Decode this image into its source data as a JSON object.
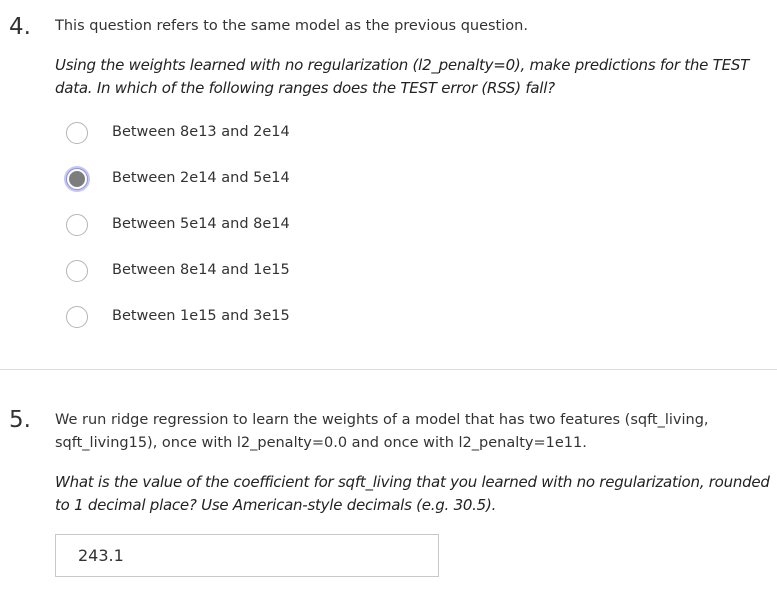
{
  "q4": {
    "number": "4.",
    "intro": "This question refers to the same model as the previous question.",
    "prompt_line1": "Using the weights learned with no regularization (l2_penalty=0), make predictions for the TEST",
    "prompt_line2": "data. In which of the following ranges does the TEST error (RSS) fall?",
    "options": [
      {
        "label": "Between 8e13 and 2e14",
        "selected": false
      },
      {
        "label": "Between 2e14 and 5e14",
        "selected": true
      },
      {
        "label": "Between 5e14 and 8e14",
        "selected": false
      },
      {
        "label": "Between 8e14 and 1e15",
        "selected": false
      },
      {
        "label": "Between 1e15 and 3e15",
        "selected": false
      }
    ]
  },
  "q5": {
    "number": "5.",
    "intro_line1": "We run ridge regression to learn the weights of a model that has two features (sqft_living,",
    "intro_line2": "sqft_living15), once with l2_penalty=0.0 and once with l2_penalty=1e11.",
    "prompt_line1": "What is the value of the coefficient for sqft_living that you learned with no regularization, rounded",
    "prompt_line2": "to 1 decimal place? Use American-style decimals (e.g. 30.5).",
    "answer_value": "243.1"
  },
  "colors": {
    "text": "#333333",
    "radio_border": "#b5b5b5",
    "radio_selected_ring": "#8f8fe0",
    "radio_selected_fill": "#7d7d7d",
    "divider": "#dddddd"
  }
}
